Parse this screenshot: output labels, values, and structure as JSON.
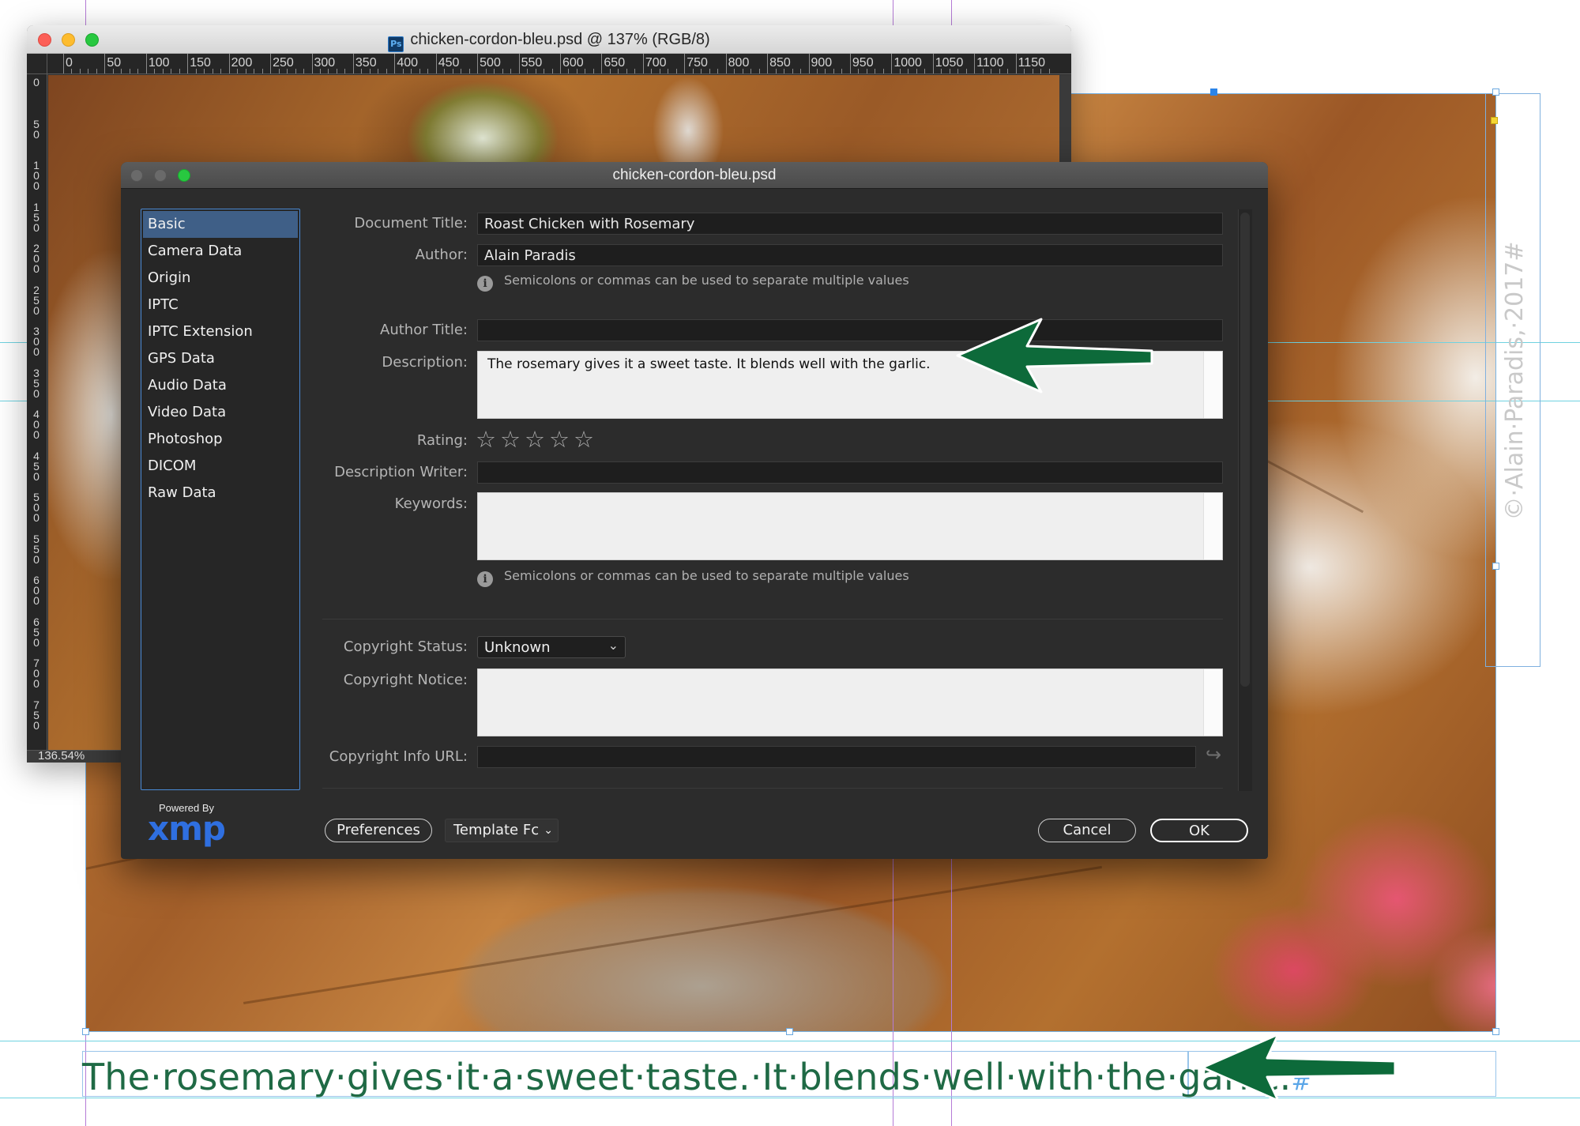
{
  "photoshop": {
    "window_title": "chicken-cordon-bleu.psd @ 137% (RGB/8)",
    "app_icon": "Ps",
    "zoom": "136.54%",
    "ruler_top_labels": [
      "0",
      "50",
      "100",
      "150",
      "200",
      "250",
      "300",
      "350",
      "400",
      "450",
      "500",
      "550",
      "600",
      "650",
      "700",
      "750",
      "800",
      "850",
      "900",
      "950",
      "1000",
      "1050",
      "1100",
      "1150"
    ],
    "ruler_left_labels": [
      "0",
      "5 0",
      "1 0 0",
      "1 5 0",
      "2 0 0",
      "2 5 0",
      "3 0 0",
      "3 5 0",
      "4 0 0",
      "4 5 0",
      "5 0 0",
      "5 5 0",
      "6 0 0",
      "6 5 0",
      "7 0 0",
      "7 5 0"
    ]
  },
  "dialog": {
    "title": "chicken-cordon-bleu.psd",
    "nav_items": [
      "Basic",
      "Camera Data",
      "Origin",
      "IPTC",
      "IPTC Extension",
      "GPS Data",
      "Audio Data",
      "Video Data",
      "Photoshop",
      "DICOM",
      "Raw Data"
    ],
    "selected_nav": "Basic",
    "powered_by": "Powered By",
    "xmp_logo": "xmp",
    "fields": {
      "document_title": {
        "label": "Document Title:",
        "value": "Roast Chicken with Rosemary"
      },
      "author": {
        "label": "Author:",
        "value": "Alain Paradis"
      },
      "author_hint": "Semicolons or commas can be used to separate multiple values",
      "author_title": {
        "label": "Author Title:",
        "value": ""
      },
      "description": {
        "label": "Description:",
        "value": "The rosemary gives it a sweet taste. It blends well with the garlic."
      },
      "rating": {
        "label": "Rating:",
        "stars": "☆☆☆☆☆",
        "value": 0,
        "max": 5
      },
      "description_writer": {
        "label": "Description Writer:",
        "value": ""
      },
      "keywords": {
        "label": "Keywords:",
        "value": ""
      },
      "keywords_hint": "Semicolons or commas can be used to separate multiple values",
      "copyright_status": {
        "label": "Copyright Status:",
        "value": "Unknown"
      },
      "copyright_notice": {
        "label": "Copyright Notice:",
        "value": ""
      },
      "copyright_info_url": {
        "label": "Copyright Info URL:",
        "value": ""
      }
    },
    "buttons": {
      "preferences": "Preferences",
      "template": "Template Fc",
      "cancel": "Cancel",
      "ok": "OK"
    }
  },
  "indesign": {
    "caption_text": "The·rosemary·gives·it·a·sweet·taste.·It·blends·well·with·the·garlic.",
    "end_marker": "#",
    "credit_text": "©·Alain·Paradis,·2017#"
  },
  "colors": {
    "arrow_green": "#0d6a3a",
    "caption_green": "#1f6a45",
    "selection_blue": "#3f5f87"
  }
}
